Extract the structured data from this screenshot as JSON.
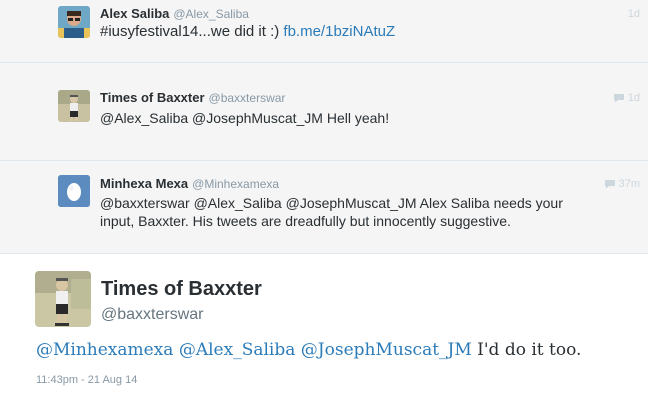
{
  "thread": {
    "tweets": [
      {
        "name": "Alex Saliba",
        "handle": "@Alex_Saliba",
        "time": "1d",
        "text": "#iusyfestival14...we did it :)",
        "link": "fb.me/1bziNAtuZ",
        "avatar_icon": "profile-photo"
      },
      {
        "name": "Times of Baxxter",
        "handle": "@baxxterswar",
        "time": "1d",
        "text": "@Alex_Saliba @JosephMuscat_JM Hell yeah!",
        "avatar_icon": "profile-photo",
        "has_reply_icon": true
      },
      {
        "name": "Minhexa Mexa",
        "handle": "@Minhexamexa",
        "time": "37m",
        "text_line1": "@baxxterswar @Alex_Saliba @JosephMuscat_JM Alex Saliba needs your",
        "text_line2": "input, Baxxter. His tweets are dreadfully but innocently suggestive.",
        "avatar_icon": "egg-avatar",
        "has_reply_icon": true
      }
    ]
  },
  "focused": {
    "name": "Times of Baxxter",
    "handle": "@baxxterswar",
    "mentions": [
      "@Minhexamexa",
      "@Alex_Saliba",
      "@JosephMuscat_JM"
    ],
    "text_tail": "I'd do it too.",
    "datetime": "11:43pm - 21 Aug 14"
  },
  "colors": {
    "link": "#2b7bb9",
    "thread_bg": "#f5f5f5",
    "egg_bg": "#5c8cbf"
  }
}
